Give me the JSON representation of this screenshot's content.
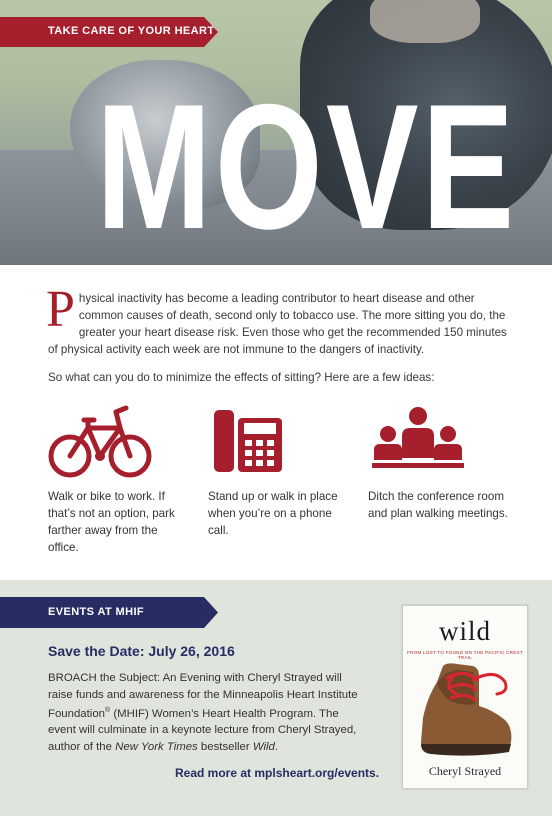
{
  "hero": {
    "banner_label": "TAKE CARE OF YOUR HEART",
    "title": "MOVE"
  },
  "intro": {
    "dropcap": "P",
    "paragraph1_rest": "hysical inactivity has become a leading contributor to heart disease and other common causes of death, second only to tobacco use. The more sitting you do, the greater your heart disease risk. Even those who get the recommended 150 minutes of physical activity each week are not immune to the dangers of inactivity.",
    "paragraph2": "So what can you do to minimize the effects of sitting? Here are a few ideas:"
  },
  "ideas": [
    {
      "icon": "bicycle-icon",
      "text": "Walk or bike to work. If that’s not an option, park farther away from the office."
    },
    {
      "icon": "phone-icon",
      "text": "Stand up or walk in place when you’re on a phone call."
    },
    {
      "icon": "meeting-icon",
      "text": "Ditch the conference room and plan walking meetings."
    }
  ],
  "events": {
    "banner_label": "EVENTS AT MHIF",
    "save_the_date": "Save the Date: July 26, 2016",
    "body_part1": "BROACH the Subject: An Evening with Cheryl Strayed will raise funds and awareness for the Minneapolis Heart Institute Foundation",
    "body_reg": "®",
    "body_part2": " (MHIF) Women’s Heart Health Program. The event will culminate in a keynote lecture from Cheryl Strayed, author of the ",
    "body_italic1": "New York Times",
    "body_part3": " bestseller ",
    "body_italic2": "Wild",
    "body_part4": ".",
    "read_more": "Read more at mplsheart.org/events."
  },
  "book": {
    "title": "wild",
    "subtitle": "FROM LOST TO FOUND ON THE PACIFIC CREST TRAIL",
    "author": "Cheryl Strayed"
  },
  "colors": {
    "accent_red": "#a61f2c",
    "navy": "#272d63",
    "events_bg": "#dfe4dd"
  }
}
